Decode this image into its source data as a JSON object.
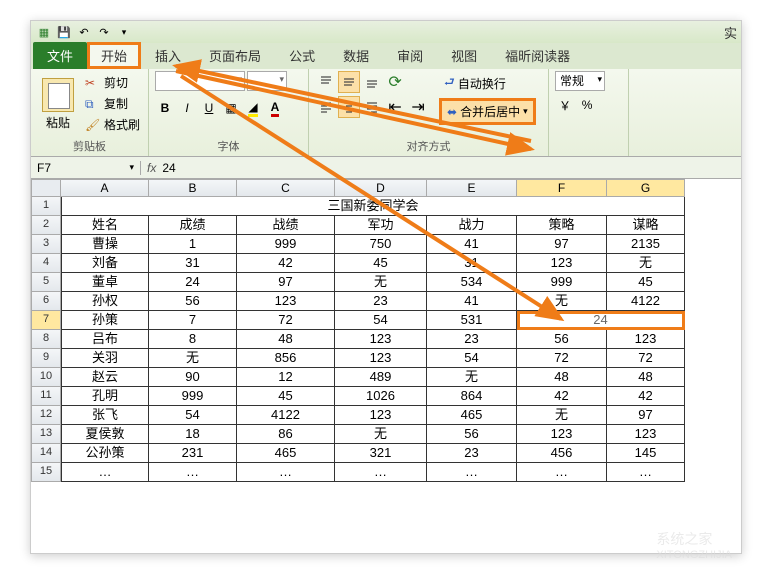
{
  "qat": {
    "experiment_label": "实"
  },
  "tabs": {
    "file": "文件",
    "home": "开始",
    "insert": "插入",
    "layout": "页面布局",
    "formula": "公式",
    "data": "数据",
    "review": "审阅",
    "view": "视图",
    "foxit": "福昕阅读器"
  },
  "ribbon": {
    "clipboard": {
      "paste": "粘贴",
      "cut": "剪切",
      "copy": "复制",
      "format_painter": "格式刷",
      "group_label": "剪贴板"
    },
    "font": {
      "bold": "B",
      "italic": "I",
      "underline": "U",
      "group_label": "字体"
    },
    "alignment": {
      "wrap": "自动换行",
      "merge": "合并后居中",
      "group_label": "对齐方式"
    },
    "number": {
      "general": "常规"
    }
  },
  "namebox": {
    "ref": "F7",
    "formula": "24"
  },
  "fx": "fx",
  "sheet": {
    "columns": [
      "A",
      "B",
      "C",
      "D",
      "E",
      "F",
      "G"
    ],
    "title": "三国新委同学会",
    "headers": [
      "姓名",
      "成绩",
      "战绩",
      "军功",
      "战力",
      "策略",
      "谋略"
    ],
    "rows": [
      [
        "曹操",
        "1",
        "999",
        "750",
        "41",
        "97",
        "2135"
      ],
      [
        "刘备",
        "31",
        "42",
        "45",
        "31",
        "123",
        "无"
      ],
      [
        "董卓",
        "24",
        "97",
        "无",
        "534",
        "999",
        "45"
      ],
      [
        "孙权",
        "56",
        "123",
        "23",
        "41",
        "无",
        "4122"
      ],
      [
        "孙策",
        "7",
        "72",
        "54",
        "531",
        "24",
        ""
      ],
      [
        "吕布",
        "8",
        "48",
        "123",
        "23",
        "56",
        "123"
      ],
      [
        "关羽",
        "无",
        "856",
        "123",
        "54",
        "72",
        "72"
      ],
      [
        "赵云",
        "90",
        "12",
        "489",
        "无",
        "48",
        "48"
      ],
      [
        "孔明",
        "999",
        "45",
        "1026",
        "864",
        "42",
        "42"
      ],
      [
        "张飞",
        "54",
        "4122",
        "123",
        "465",
        "无",
        "97"
      ],
      [
        "夏侯敦",
        "18",
        "86",
        "无",
        "56",
        "123",
        "123"
      ],
      [
        "公孙策",
        "231",
        "465",
        "321",
        "23",
        "456",
        "145"
      ],
      [
        "…",
        "…",
        "…",
        "…",
        "…",
        "…",
        "…"
      ]
    ],
    "row_numbers": [
      "1",
      "2",
      "3",
      "4",
      "5",
      "6",
      "7",
      "8",
      "9",
      "10",
      "11",
      "12",
      "13",
      "14",
      "15"
    ]
  },
  "chart_data": {
    "type": "table",
    "title": "三国新委同学会",
    "columns": [
      "姓名",
      "成绩",
      "战绩",
      "军功",
      "战力",
      "策略",
      "谋略"
    ],
    "data": [
      {
        "姓名": "曹操",
        "成绩": 1,
        "战绩": 999,
        "军功": 750,
        "战力": 41,
        "策略": 97,
        "谋略": 2135
      },
      {
        "姓名": "刘备",
        "成绩": 31,
        "战绩": 42,
        "军功": 45,
        "战力": 31,
        "策略": 123,
        "谋略": "无"
      },
      {
        "姓名": "董卓",
        "成绩": 24,
        "战绩": 97,
        "军功": "无",
        "战力": 534,
        "策略": 999,
        "谋略": 45
      },
      {
        "姓名": "孙权",
        "成绩": 56,
        "战绩": 123,
        "军功": 23,
        "战力": 41,
        "策略": "无",
        "谋略": 4122
      },
      {
        "姓名": "孙策",
        "成绩": 7,
        "战绩": 72,
        "军功": 54,
        "战力": 531,
        "策略": 24,
        "谋略": 24
      },
      {
        "姓名": "吕布",
        "成绩": 8,
        "战绩": 48,
        "军功": 123,
        "战力": 23,
        "策略": 56,
        "谋略": 123
      },
      {
        "姓名": "关羽",
        "成绩": "无",
        "战绩": 856,
        "军功": 123,
        "战力": 54,
        "策略": 72,
        "谋略": 72
      },
      {
        "姓名": "赵云",
        "成绩": 90,
        "战绩": 12,
        "军功": 489,
        "战力": "无",
        "策略": 48,
        "谋略": 48
      },
      {
        "姓名": "孔明",
        "成绩": 999,
        "战绩": 45,
        "军功": 1026,
        "战力": 864,
        "策略": 42,
        "谋略": 42
      },
      {
        "姓名": "张飞",
        "成绩": 54,
        "战绩": 4122,
        "军功": 123,
        "战力": 465,
        "策略": "无",
        "谋略": 97
      },
      {
        "姓名": "夏侯敦",
        "成绩": 18,
        "战绩": 86,
        "军功": "无",
        "战力": 56,
        "策略": 123,
        "谋略": 123
      },
      {
        "姓名": "公孙策",
        "成绩": 231,
        "战绩": 465,
        "军功": 321,
        "战力": 23,
        "策略": 456,
        "谋略": 145
      }
    ],
    "merged_cell": {
      "range": "F7:G7",
      "value": 24
    }
  },
  "watermark": {
    "brand": "系统之家",
    "url": "XITONGZHIJIA"
  }
}
